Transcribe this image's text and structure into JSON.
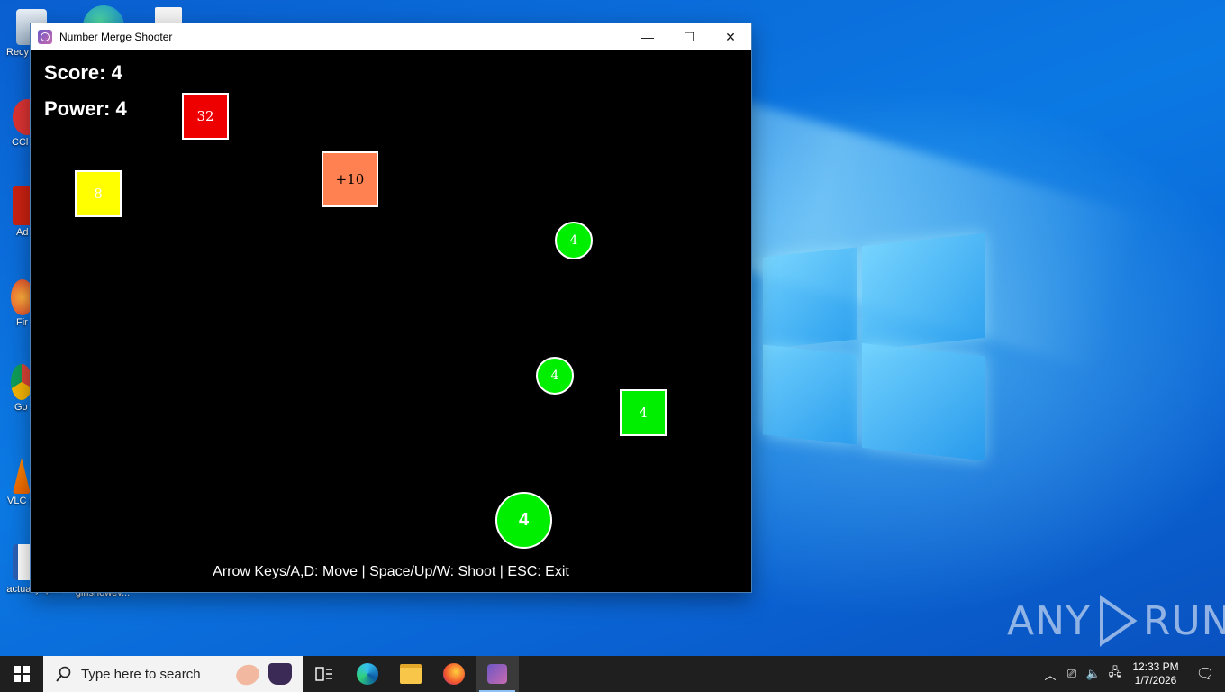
{
  "window": {
    "title": "Number Merge Shooter",
    "controls": {
      "minimize": "—",
      "maximize": "☐",
      "close": "✕"
    }
  },
  "game": {
    "score_text": "Score: 4",
    "power_text": "Power: 4",
    "help_text": "Arrow Keys/A,D: Move | Space/Up/W: Shoot | ESC: Exit",
    "blocks": [
      {
        "label": "32",
        "color": "#ee0000"
      },
      {
        "label": "8",
        "color": "#ffff00"
      },
      {
        "label": "+10",
        "color": "#ff8050"
      },
      {
        "label": "4",
        "color": "#00ee00"
      }
    ],
    "bullets": [
      {
        "label": "4"
      },
      {
        "label": "4"
      }
    ],
    "player": {
      "label": "4",
      "color": "#00ee00"
    }
  },
  "desktop": {
    "icons": [
      {
        "label": "Recy"
      },
      {
        "label": "CCl"
      },
      {
        "label": "Ad Acr"
      },
      {
        "label": "Fir"
      },
      {
        "label": "Go Chr"
      },
      {
        "label": "VLC pla"
      },
      {
        "label": "actuallyopi..."
      },
      {
        "label": "girlshowev..."
      }
    ],
    "watermark": {
      "left": "ANY",
      "right": "RUN"
    }
  },
  "taskbar": {
    "search_placeholder": "Type here to search",
    "clock_time": "12:33 PM",
    "clock_date": "1/7/2026"
  }
}
